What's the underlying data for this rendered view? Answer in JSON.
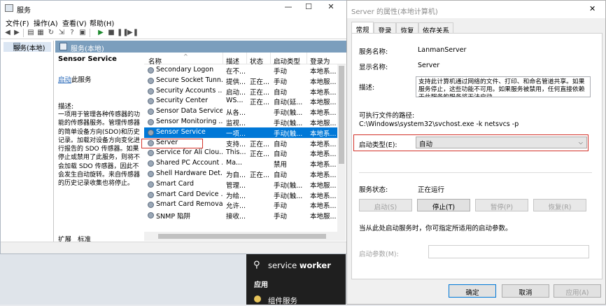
{
  "services_window": {
    "title": "服务",
    "controls": {
      "min": "—",
      "max": "☐",
      "close": "✕"
    },
    "menu": [
      "文件(F)",
      "操作(A)",
      "查看(V)",
      "帮助(H)"
    ],
    "tree_item": "服务(本地)",
    "header": "服务(本地)",
    "desc_panel": {
      "name": "Sensor Service",
      "link": "启动",
      "link_suffix": "此服务",
      "desc_label": "描述:",
      "desc_text": "一项用于管理各种传感器的功能的传感器服务。管理传感器的简单设备方向(SDO)和历史记录。加载对设备方向变化进行报告的 SDO 传感器。如果停止或禁用了此服务，则将不会加载 SDO 传感器，因此不会发生自动旋转。来自传感器的历史记录收集也将停止。"
    },
    "bottom_tabs": [
      "扩展",
      "标准"
    ],
    "columns": [
      "名称",
      "描述",
      "状态",
      "启动类型",
      "登录为"
    ],
    "rows": [
      {
        "name": "Secondary Logon",
        "desc": "在不...",
        "status": "",
        "startup": "手动",
        "logon": "本地系..."
      },
      {
        "name": "Secure Socket Tunn...",
        "desc": "提供...",
        "status": "正在...",
        "startup": "手动",
        "logon": "本地服..."
      },
      {
        "name": "Security Accounts ...",
        "desc": "启动...",
        "status": "正在...",
        "startup": "自动",
        "logon": "本地系..."
      },
      {
        "name": "Security Center",
        "desc": "WS...",
        "status": "正在...",
        "startup": "自动(延...",
        "logon": "本地服..."
      },
      {
        "name": "Sensor Data Service",
        "desc": "从各...",
        "status": "",
        "startup": "手动(触...",
        "logon": "本地系..."
      },
      {
        "name": "Sensor Monitoring ...",
        "desc": "监视...",
        "status": "",
        "startup": "手动(触...",
        "logon": "本地服..."
      },
      {
        "name": "Sensor Service",
        "desc": "一项...",
        "status": "",
        "startup": "手动(触...",
        "logon": "本地系..."
      },
      {
        "name": "Server",
        "desc": "支持...",
        "status": "正在...",
        "startup": "自动",
        "logon": "本地系..."
      },
      {
        "name": "Service for Ali Clou...",
        "desc": "This...",
        "status": "正在...",
        "startup": "自动",
        "logon": "本地系..."
      },
      {
        "name": "Shared PC Account ...",
        "desc": "Ma...",
        "status": "",
        "startup": "禁用",
        "logon": "本地系..."
      },
      {
        "name": "Shell Hardware Det...",
        "desc": "为自...",
        "status": "正在...",
        "startup": "自动",
        "logon": "本地系..."
      },
      {
        "name": "Smart Card",
        "desc": "管理...",
        "status": "",
        "startup": "手动(触...",
        "logon": "本地服..."
      },
      {
        "name": "Smart Card Device ...",
        "desc": "为给...",
        "status": "",
        "startup": "手动(触...",
        "logon": "本地系..."
      },
      {
        "name": "Smart Card Remova...",
        "desc": "允许...",
        "status": "",
        "startup": "手动",
        "logon": "本地系..."
      },
      {
        "name": "SNMP 陷阱",
        "desc": "接收...",
        "status": "",
        "startup": "手动",
        "logon": "本地服..."
      }
    ],
    "selected_row": "Sensor Service",
    "highlighted_row": "Server"
  },
  "properties_dialog": {
    "title": "Server 的属性(本地计算机)",
    "tabs": [
      "常规",
      "登录",
      "恢复",
      "依存关系"
    ],
    "active_tab": "常规",
    "service_name_label": "服务名称:",
    "service_name": "LanmanServer",
    "display_name_label": "显示名称:",
    "display_name": "Server",
    "description_label": "描述:",
    "description": "支持此计算机通过网络的文件、打印、和命名管道共享。如果服务停止，这些功能不可用。如果服务被禁用，任何直接依赖于此服务的服务将无法启动。",
    "exe_path_label": "可执行文件的路径:",
    "exe_path": "C:\\Windows\\system32\\svchost.exe -k netsvcs -p",
    "startup_type_label": "启动类型(E):",
    "startup_type": "自动",
    "service_status_label": "服务状态:",
    "service_status": "正在运行",
    "buttons": {
      "start": "启动(S)",
      "stop": "停止(T)",
      "pause": "暂停(P)",
      "resume": "恢复(R)"
    },
    "hint": "当从此处启动服务时，你可指定所适用的启动参数。",
    "start_params_label": "启动参数(M):",
    "footer": {
      "ok": "确定",
      "cancel": "取消",
      "apply": "应用(A)"
    },
    "close": "✕"
  },
  "search_popup": {
    "query_prefix": "service",
    "query_bold": "worker",
    "section": "应用",
    "app": "组件服务"
  },
  "colors": {
    "selection": "#0078d7",
    "header": "#7b9ebd",
    "highlight_border": "#d3332b"
  }
}
